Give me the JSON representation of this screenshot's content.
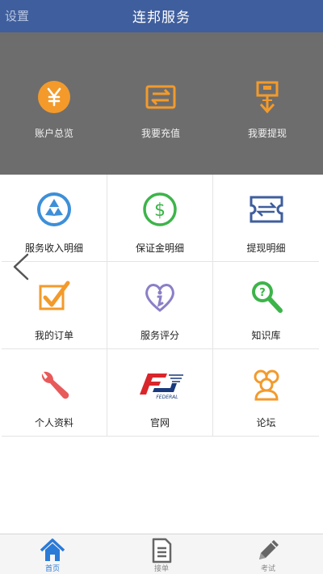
{
  "header": {
    "settings_label": "设置",
    "title": "连邦服务"
  },
  "hero": {
    "items": [
      {
        "label": "账户总览",
        "icon": "yen-icon"
      },
      {
        "label": "我要充值",
        "icon": "recharge-icon"
      },
      {
        "label": "我要提现",
        "icon": "withdraw-icon"
      }
    ]
  },
  "grid": {
    "items": [
      {
        "label": "服务收入明细",
        "icon": "recycle-icon"
      },
      {
        "label": "保证金明细",
        "icon": "dollar-icon"
      },
      {
        "label": "提现明细",
        "icon": "transfer-ticket-icon"
      },
      {
        "label": "我的订单",
        "icon": "checkbox-icon"
      },
      {
        "label": "服务评分",
        "icon": "heart-info-icon"
      },
      {
        "label": "知识库",
        "icon": "magnifier-question-icon"
      },
      {
        "label": "个人资料",
        "icon": "wrench-icon"
      },
      {
        "label": "官网",
        "icon": "federal-logo-icon",
        "logo_text": "FEDERAL"
      },
      {
        "label": "论坛",
        "icon": "people-icon"
      }
    ]
  },
  "tabs": [
    {
      "label": "首页",
      "icon": "home-icon",
      "active": true
    },
    {
      "label": "接单",
      "icon": "document-icon",
      "active": false
    },
    {
      "label": "考试",
      "icon": "pencil-icon",
      "active": false
    }
  ],
  "colors": {
    "header_bg": "#3f5e9d",
    "hero_bg": "#6d6d6d",
    "orange": "#f39a2b",
    "blue": "#3d8fd8",
    "green": "#3db44a",
    "active_tab": "#2a7ad8"
  }
}
